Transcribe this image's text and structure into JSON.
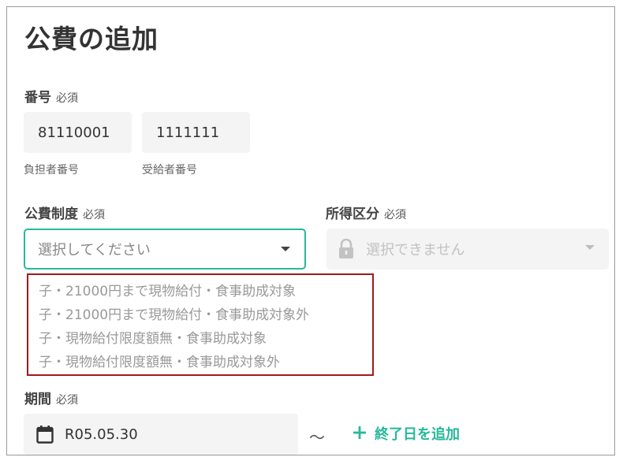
{
  "page": {
    "title": "公費の追加"
  },
  "number": {
    "label": "番号",
    "required": "必須",
    "payer_value": "81110001",
    "payer_caption": "負担者番号",
    "recipient_value": "1111111",
    "recipient_caption": "受給者番号"
  },
  "system": {
    "label": "公費制度",
    "required": "必須",
    "placeholder": "選択してください",
    "options": [
      "子・21000円まで現物給付・食事助成対象",
      "子・21000円まで現物給付・食事助成対象外",
      "子・現物給付限度額無・食事助成対象",
      "子・現物給付限度額無・食事助成対象外"
    ]
  },
  "income": {
    "label": "所得区分",
    "required": "必須",
    "placeholder": "選択できません"
  },
  "period": {
    "label": "期間",
    "required": "必須",
    "start_value": "R05.05.30",
    "separator": "〜",
    "add_end_label": "終了日を追加"
  },
  "icons": {
    "calendar": "calendar-icon",
    "lock": "lock-icon",
    "plus": "plus-icon",
    "dropdown": "chevron-down-icon"
  },
  "colors": {
    "accent": "#26b99a",
    "highlight_border": "#a11a1a"
  }
}
